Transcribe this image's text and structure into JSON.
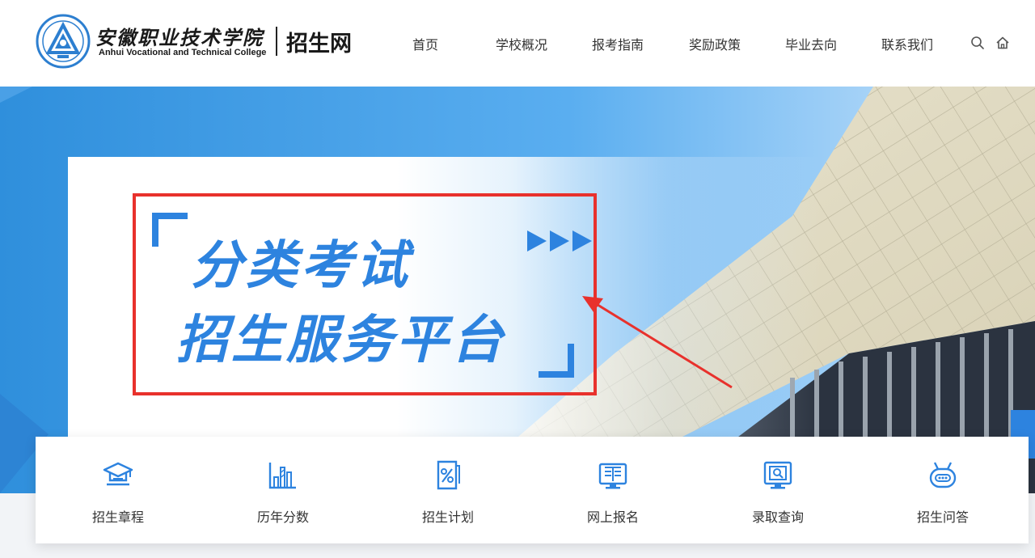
{
  "brand": {
    "name_cn": "安徽职业技术学院",
    "name_en": "Anhui Vocational and Technical College",
    "site": "招生网"
  },
  "nav": {
    "items": [
      "首页",
      "学校概况",
      "报考指南",
      "奖励政策",
      "毕业去向",
      "联系我们"
    ]
  },
  "header_icons": [
    "search-icon",
    "home-icon"
  ],
  "banner": {
    "line1": "分类考试",
    "line2": "招生服务平台",
    "accent_color": "#2d83df",
    "highlight_color": "#e8312c"
  },
  "quick_links": [
    {
      "label": "招生章程",
      "icon": "graduation-cap-icon"
    },
    {
      "label": "历年分数",
      "icon": "bar-chart-icon"
    },
    {
      "label": "招生计划",
      "icon": "percent-document-icon"
    },
    {
      "label": "网上报名",
      "icon": "book-monitor-icon"
    },
    {
      "label": "录取查询",
      "icon": "search-monitor-icon"
    },
    {
      "label": "招生问答",
      "icon": "robot-chat-icon"
    }
  ]
}
